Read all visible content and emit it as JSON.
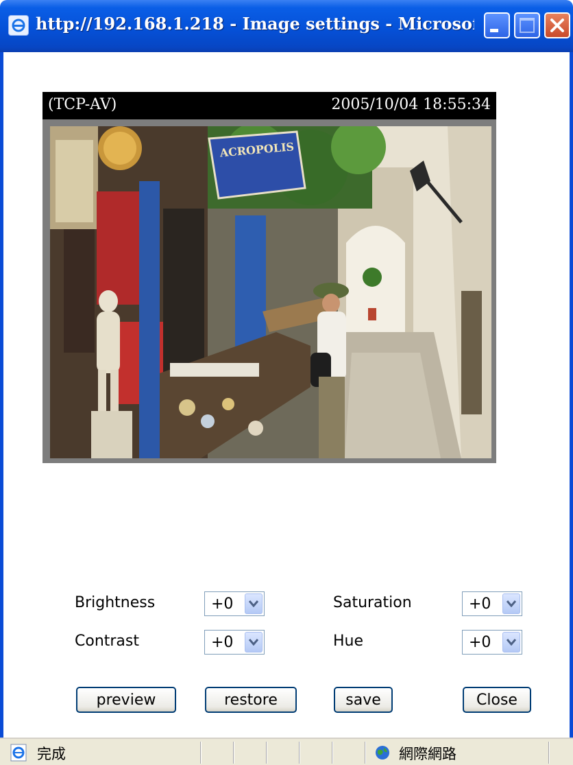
{
  "window": {
    "title": "http://192.168.1.218 - Image settings - Microsoft Inter...",
    "app_icon": "ie-icon",
    "controls": [
      "minimize",
      "maximize",
      "close"
    ]
  },
  "camera": {
    "overlay_label": "(TCP-AV)",
    "timestamp": "2005/10/04 18:55:34",
    "sign_text": "ACROPOLIS"
  },
  "settings": {
    "brightness": {
      "label": "Brightness",
      "value": "+0"
    },
    "contrast": {
      "label": "Contrast",
      "value": "+0"
    },
    "saturation": {
      "label": "Saturation",
      "value": "+0"
    },
    "hue": {
      "label": "Hue",
      "value": "+0"
    }
  },
  "buttons": {
    "preview": "preview",
    "restore": "restore",
    "save": "save",
    "close": "Close"
  },
  "statusbar": {
    "status": "完成",
    "zone": "網際網路"
  },
  "colors": {
    "titlebar": "#0551d8",
    "button_border": "#003c74",
    "close_button": "#c94a2a"
  }
}
